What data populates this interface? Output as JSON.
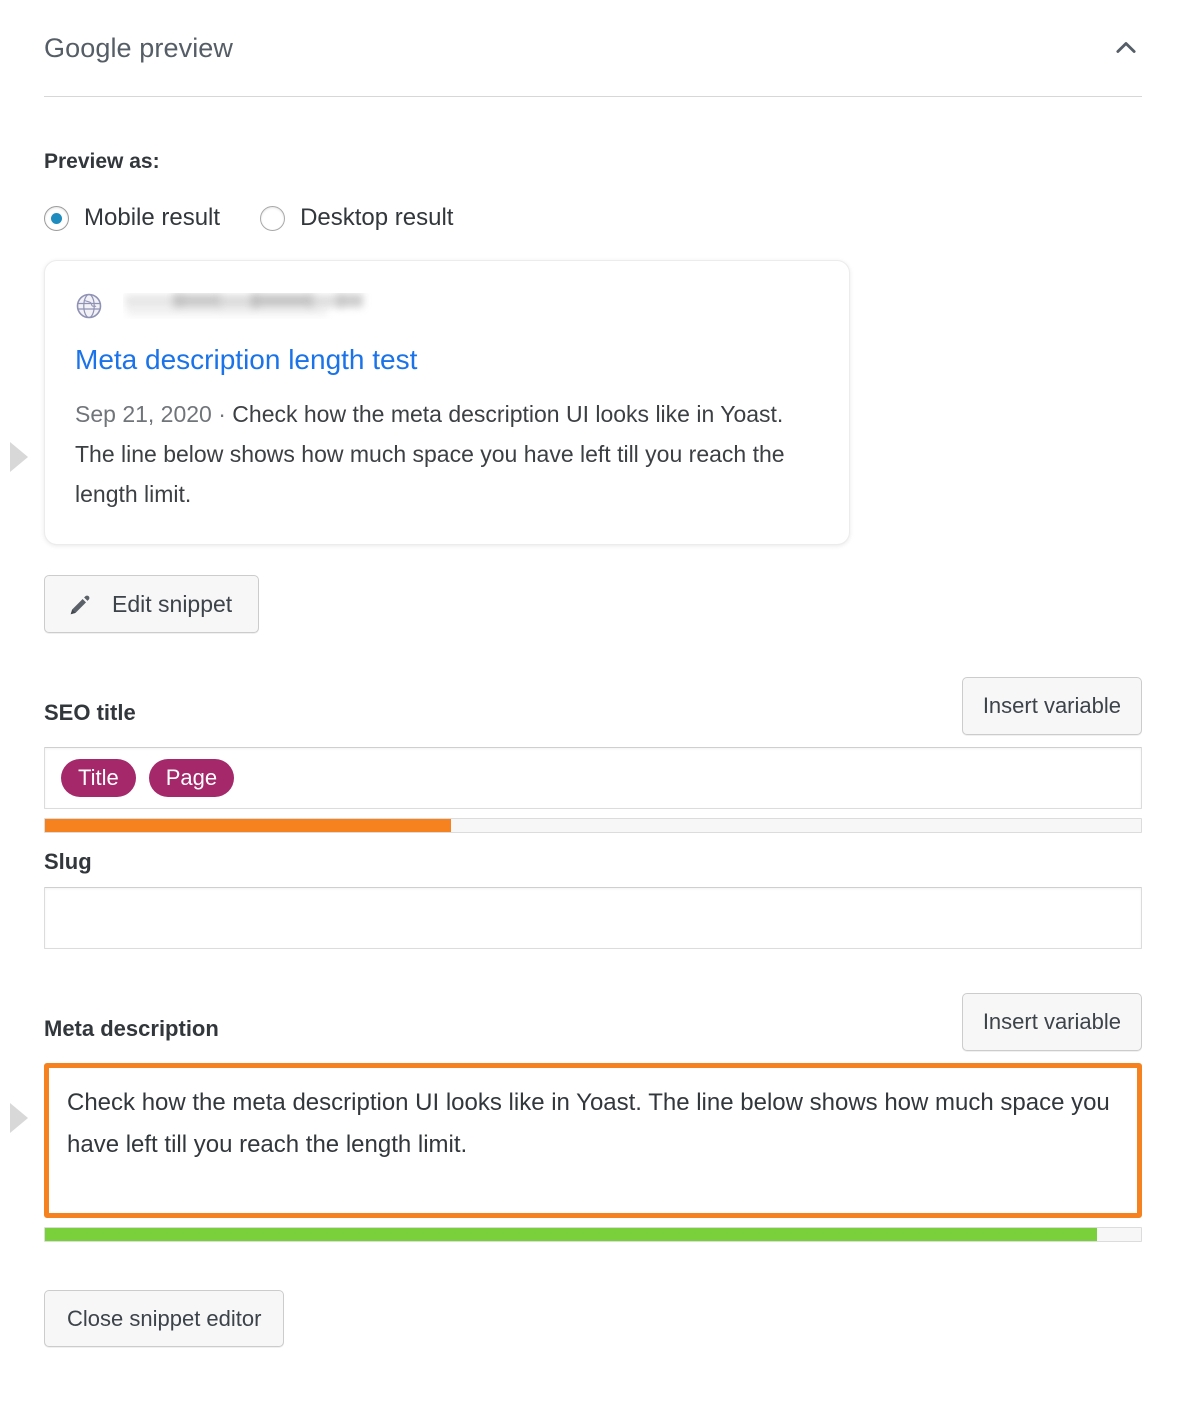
{
  "panel": {
    "title": "Google preview",
    "collapse_icon": "chevron-up-icon"
  },
  "preview_as": {
    "label": "Preview as:",
    "options": [
      {
        "label": "Mobile result",
        "selected": true
      },
      {
        "label": "Desktop result",
        "selected": false
      }
    ],
    "selected_color": "#1e8cbe"
  },
  "snippet_preview": {
    "favicon_icon": "globe-icon",
    "url": "",
    "url_redacted": true,
    "title": "Meta description length test",
    "title_color": "#1a73e8",
    "date": "Sep 21, 2020",
    "separator": "·",
    "description": "Check how the meta description UI looks like in Yoast. The line below shows how much space you have left till you reach the length limit."
  },
  "edit_snippet": {
    "label": "Edit snippet",
    "icon": "pencil-icon"
  },
  "seo_title": {
    "label": "SEO title",
    "insert_variable_label": "Insert variable",
    "pills": [
      "Title",
      "Page"
    ],
    "pill_color": "#a4286a",
    "progress": {
      "percent": 37,
      "color": "#f5821f"
    }
  },
  "slug": {
    "label": "Slug",
    "value": "",
    "placeholder": ""
  },
  "meta_description": {
    "label": "Meta description",
    "insert_variable_label": "Insert variable",
    "value": "Check how the meta description UI looks like in Yoast. The line below shows how much space you have left till you reach the length limit.",
    "focus_border_color": "#f5821f",
    "progress": {
      "percent": 96,
      "color": "#7ad03a"
    }
  },
  "close_snippet": {
    "label": "Close snippet editor"
  }
}
